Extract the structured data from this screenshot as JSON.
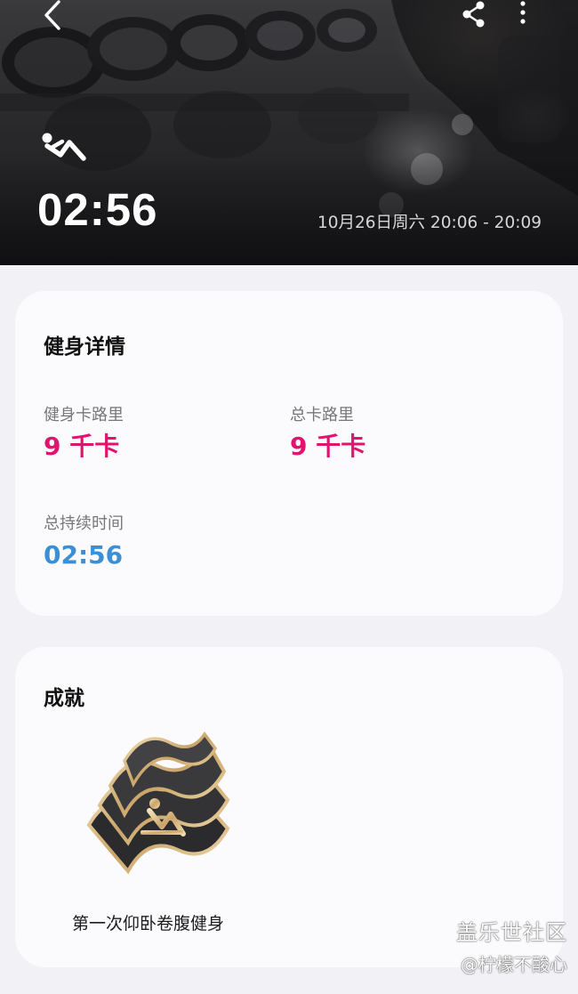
{
  "hero": {
    "duration": "02:56",
    "date_range": "10月26日周六 20:06 - 20:09",
    "icons": {
      "back": "chevron-left-icon",
      "share": "share-icon",
      "more": "more-vertical-icon",
      "workout": "sit-up-icon"
    }
  },
  "details": {
    "title": "健身详情",
    "workout_calories_label": "健身卡路里",
    "workout_calories_value": "9 千卡",
    "total_calories_label": "总卡路里",
    "total_calories_value": "9 千卡",
    "total_duration_label": "总持续时间",
    "total_duration_value": "02:56"
  },
  "achievements": {
    "title": "成就",
    "badge_label": "第一次仰卧卷腹健身"
  },
  "watermark": {
    "title": "盖乐世社区",
    "user": "@柠檬不酸心"
  },
  "colors": {
    "calories": "#e0136f",
    "duration": "#3b8fd4",
    "background": "#f2f1f6",
    "card": "#fbfbfd"
  }
}
